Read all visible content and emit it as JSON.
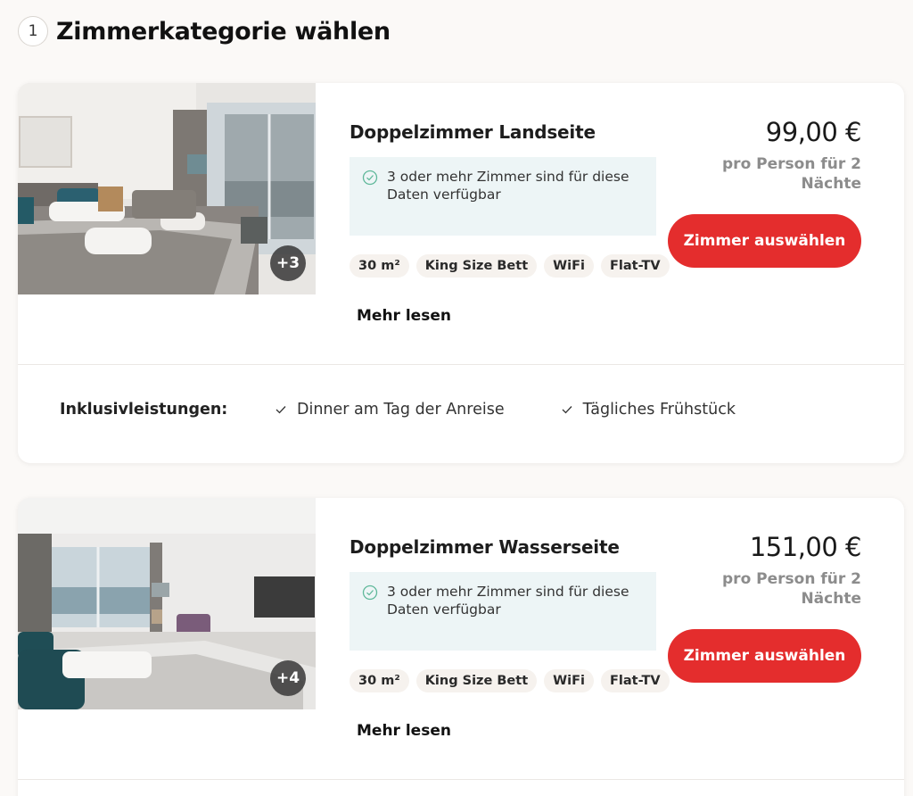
{
  "step": {
    "number": "1",
    "title": "Zimmerkategorie wählen"
  },
  "rooms": [
    {
      "photo_count": "+3",
      "name": "Doppelzimmer Landseite",
      "availability": "3 oder mehr Zimmer sind für diese Daten verfügbar",
      "tags": [
        "30 m²",
        "King Size Bett",
        "WiFi",
        "Flat-TV"
      ],
      "more": "Mehr lesen",
      "price": "99,00 €",
      "price_sub": "pro Person für 2 Nächte",
      "button": "Zimmer auswählen",
      "inclusive_label": "Inklusivleistungen:",
      "inclusives": [
        "Dinner am Tag der Anreise",
        "Tägliches Frühstück"
      ]
    },
    {
      "photo_count": "+4",
      "name": "Doppelzimmer Wasserseite",
      "availability": "3 oder mehr Zimmer sind für diese Daten verfügbar",
      "tags": [
        "30 m²",
        "King Size Bett",
        "WiFi",
        "Flat-TV"
      ],
      "more": "Mehr lesen",
      "price": "151,00 €",
      "price_sub": "pro Person für 2 Nächte",
      "button": "Zimmer auswählen"
    }
  ],
  "colors": {
    "accent": "#e42d2d",
    "availability_bg": "#edf5f6",
    "check_green": "#5fb89a",
    "page_bg": "#fbf9f7"
  }
}
